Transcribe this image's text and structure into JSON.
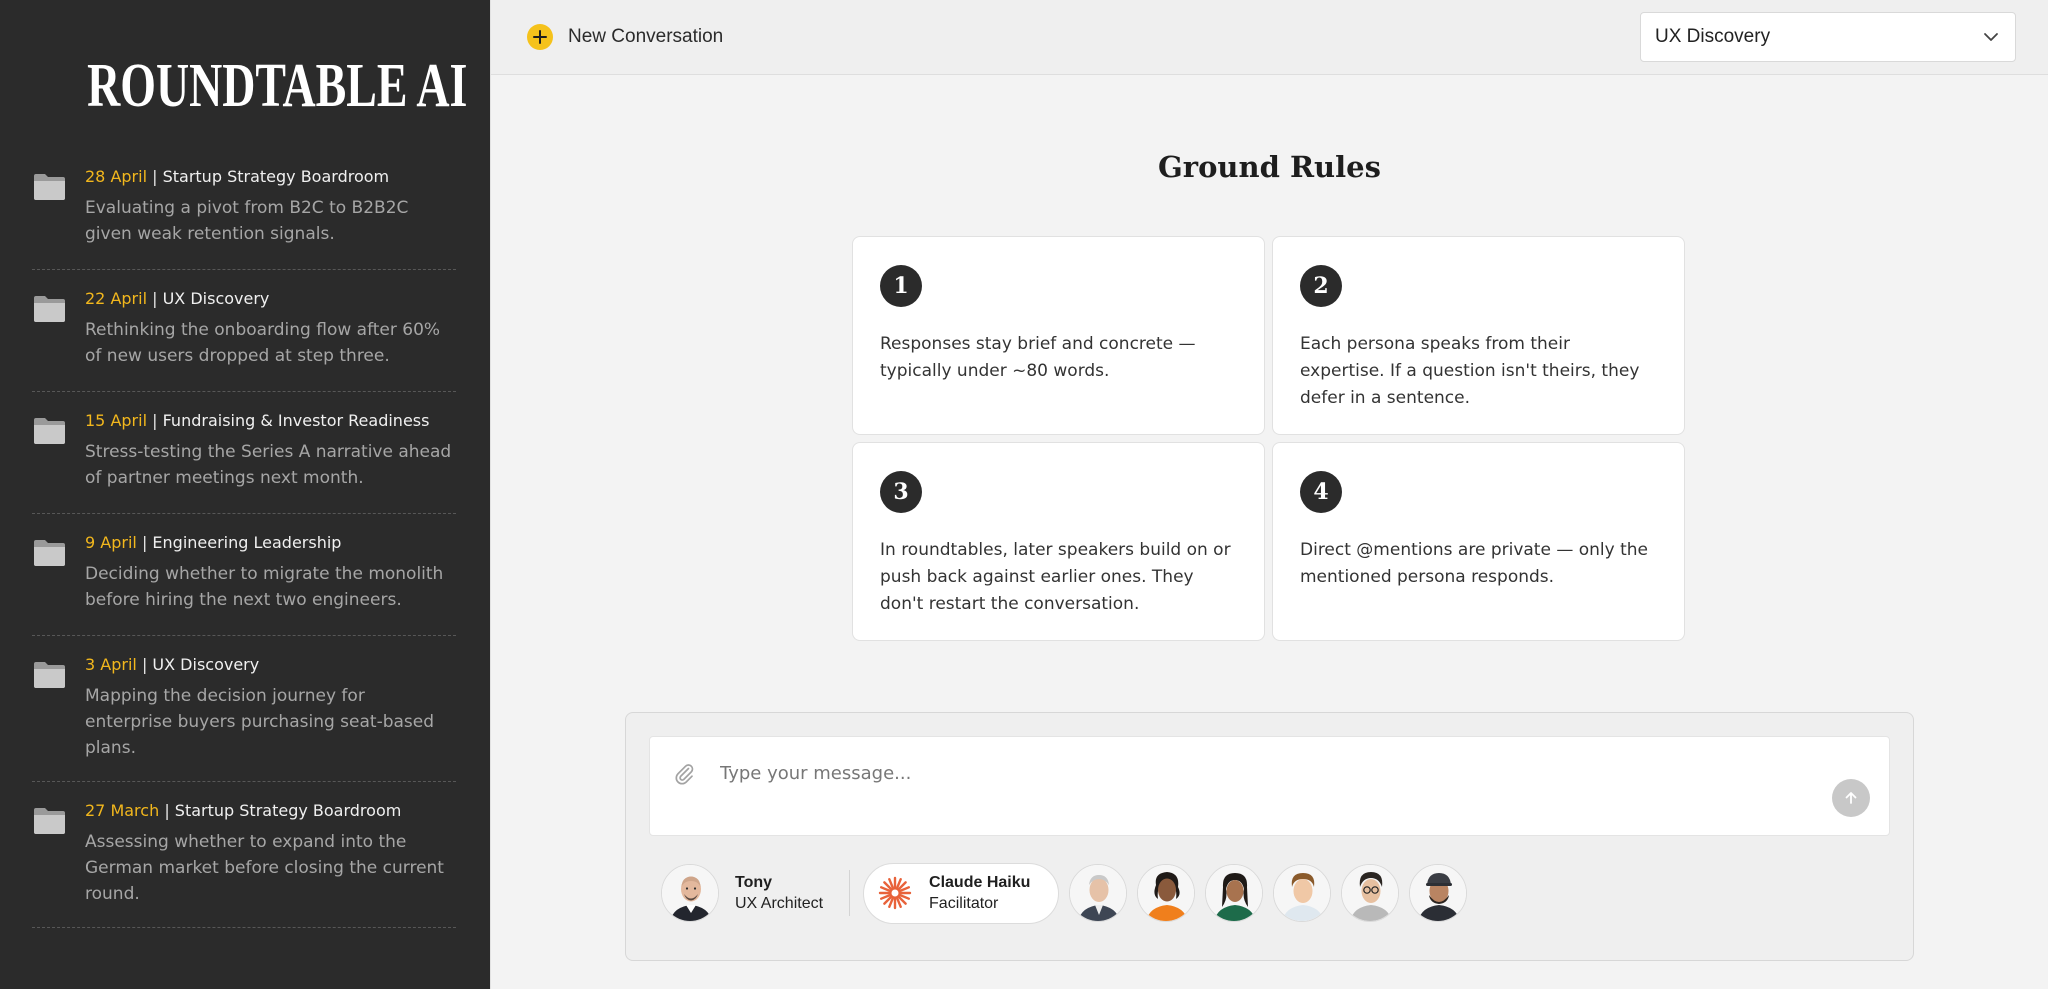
{
  "app": {
    "name": "ROUNDTABLE AI"
  },
  "sidebar": {
    "items": [
      {
        "date": "28 April",
        "separator": "|",
        "board": "Startup Strategy Boardroom",
        "desc": "Evaluating a pivot from B2C to B2B2C given weak retention signals."
      },
      {
        "date": "22 April",
        "separator": "|",
        "board": "UX Discovery",
        "desc": "Rethinking the onboarding flow after 60% of new users dropped at step three."
      },
      {
        "date": "15 April",
        "separator": "|",
        "board": "Fundraising & Investor Readiness",
        "desc": "Stress-testing the Series A narrative ahead of partner meetings next month."
      },
      {
        "date": "9 April",
        "separator": "|",
        "board": "Engineering Leadership",
        "desc": "Deciding whether to migrate the monolith before hiring the next two engineers."
      },
      {
        "date": "3 April",
        "separator": "|",
        "board": "UX Discovery",
        "desc": "Mapping the decision journey for enterprise buyers purchasing seat-based plans."
      },
      {
        "date": "27 March",
        "separator": "|",
        "board": "Startup Strategy Boardroom",
        "desc": "Assessing whether to expand into the German market before closing the current round."
      }
    ]
  },
  "topbar": {
    "new_conversation": "New Conversation",
    "board_select": {
      "value": "UX Discovery"
    }
  },
  "rules": {
    "title": "Ground Rules",
    "items": [
      {
        "num": "1",
        "text": "Responses stay brief and concrete — typically under ~80 words."
      },
      {
        "num": "2",
        "text": "Each persona speaks from their expertise. If a question isn't theirs, they defer in a sentence."
      },
      {
        "num": "3",
        "text": "In roundtables, later speakers build on or push back against earlier ones. They don't restart the conversation."
      },
      {
        "num": "4",
        "text": "Direct @mentions are private — only the mentioned persona responds."
      }
    ]
  },
  "composer": {
    "placeholder": "Type your message...",
    "active_persona": {
      "name": "Tony",
      "role": "UX Architect"
    },
    "facilitator": {
      "name": "Claude Haiku",
      "role": "Facilitator"
    },
    "other_personas": 6
  },
  "colors": {
    "sidebar_bg": "#2b2b2b",
    "accent": "#f2b71d",
    "plus_button": "#f5c21b",
    "main_bg": "#f3f3f3",
    "facilitator_mark": "#e8623a"
  },
  "icons": [
    "folder-icon",
    "plus-icon",
    "chevron-down-icon",
    "paperclip-icon",
    "send-arrow-icon",
    "claude-starburst-icon"
  ]
}
